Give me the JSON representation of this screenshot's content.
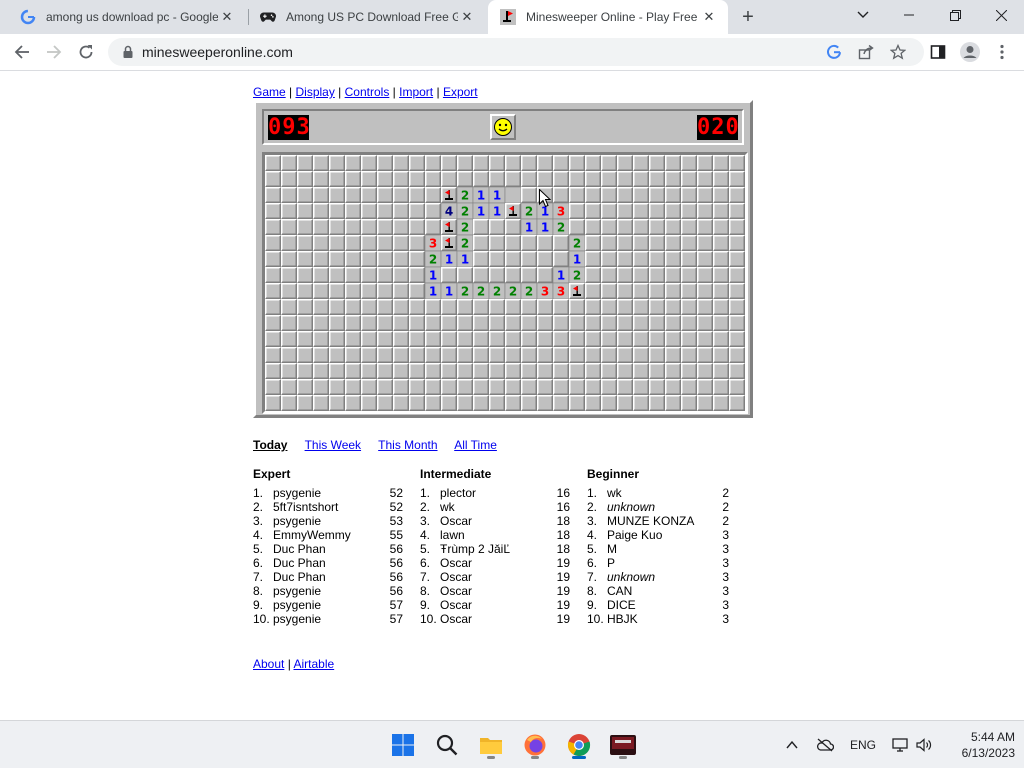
{
  "browser": {
    "tabs": [
      {
        "title": "among us download pc - Google Search",
        "icon": "google-icon"
      },
      {
        "title": "Among US PC Download Free Game",
        "icon": "gamepad-icon"
      },
      {
        "title": "Minesweeper Online - Play Free Online",
        "icon": "mine-icon",
        "active": true
      }
    ],
    "url": "minesweeperonline.com"
  },
  "menu": {
    "items": [
      "Game",
      "Display",
      "Controls",
      "Import",
      "Export"
    ],
    "separator": " | "
  },
  "game": {
    "mines_left": "093",
    "timer": "020",
    "face": "smiley-face-icon",
    "rows": 16,
    "cols": 30,
    "revealed": [
      "..............................",
      "..............................",
      "...........?2110..............",
      "...........4211?213...........",
      "...........?2...112...........",
      "..........3?2......2..........",
      "..........211......1..........",
      "..........1.......12..........",
      "..........112222233?..........",
      "..............................",
      "..............................",
      "..............................",
      "..............................",
      "..............................",
      "..............................",
      ".............................."
    ],
    "flags": [
      [
        2,
        13
      ],
      [
        2,
        16
      ],
      [
        3,
        16
      ],
      [
        4,
        13
      ],
      [
        5,
        13
      ],
      [
        8,
        19
      ],
      [
        3,
        17
      ]
    ]
  },
  "colors": {
    "n1": "#0000ff",
    "n2": "#008000",
    "n3": "#ff0000",
    "n4": "#000080"
  },
  "periods": {
    "today": "Today",
    "week": "This Week",
    "month": "This Month",
    "all": "All Time"
  },
  "highscores": {
    "expert": {
      "title": "Expert",
      "rows": [
        {
          "rank": "1.",
          "name": "psygenie",
          "time": "52"
        },
        {
          "rank": "2.",
          "name": "5ft7isntshort",
          "time": "52"
        },
        {
          "rank": "3.",
          "name": "psygenie",
          "time": "53"
        },
        {
          "rank": "4.",
          "name": "EmmyWemmy",
          "time": "55"
        },
        {
          "rank": "5.",
          "name": "Duc Phan",
          "time": "56"
        },
        {
          "rank": "6.",
          "name": "Duc Phan",
          "time": "56"
        },
        {
          "rank": "7.",
          "name": "Duc Phan",
          "time": "56"
        },
        {
          "rank": "8.",
          "name": "psygenie",
          "time": "56"
        },
        {
          "rank": "9.",
          "name": "psygenie",
          "time": "57"
        },
        {
          "rank": "10.",
          "name": "psygenie",
          "time": "57"
        }
      ]
    },
    "intermediate": {
      "title": "Intermediate",
      "rows": [
        {
          "rank": "1.",
          "name": "plector",
          "time": "16"
        },
        {
          "rank": "2.",
          "name": "wk",
          "time": "16"
        },
        {
          "rank": "3.",
          "name": "Oscar",
          "time": "18"
        },
        {
          "rank": "4.",
          "name": "lawn",
          "time": "18"
        },
        {
          "rank": "5.",
          "name": "Ŧrùmp 2 JǎiĽ",
          "time": "18"
        },
        {
          "rank": "6.",
          "name": "Oscar",
          "time": "19"
        },
        {
          "rank": "7.",
          "name": "Oscar",
          "time": "19"
        },
        {
          "rank": "8.",
          "name": "Oscar",
          "time": "19"
        },
        {
          "rank": "9.",
          "name": "Oscar",
          "time": "19"
        },
        {
          "rank": "10.",
          "name": "Oscar",
          "time": "19"
        }
      ]
    },
    "beginner": {
      "title": "Beginner",
      "rows": [
        {
          "rank": "1.",
          "name": "wk",
          "time": "2"
        },
        {
          "rank": "2.",
          "name": "unknown",
          "time": "2",
          "unknown": true
        },
        {
          "rank": "3.",
          "name": "MUNZE KONZA",
          "time": "2"
        },
        {
          "rank": "4.",
          "name": "Paige Kuo",
          "time": "3"
        },
        {
          "rank": "5.",
          "name": "M",
          "time": "3"
        },
        {
          "rank": "6.",
          "name": "P",
          "time": "3"
        },
        {
          "rank": "7.",
          "name": "unknown",
          "time": "3",
          "unknown": true
        },
        {
          "rank": "8.",
          "name": "CAN",
          "time": "3"
        },
        {
          "rank": "9.",
          "name": "DICE",
          "time": "3"
        },
        {
          "rank": "10.",
          "name": "HBJK",
          "time": "3"
        }
      ]
    }
  },
  "footer": {
    "about": "About",
    "sep": " | ",
    "airtable": "Airtable"
  },
  "taskbar": {
    "lang": "ENG",
    "time": "5:44 AM",
    "date": "6/13/2023"
  }
}
